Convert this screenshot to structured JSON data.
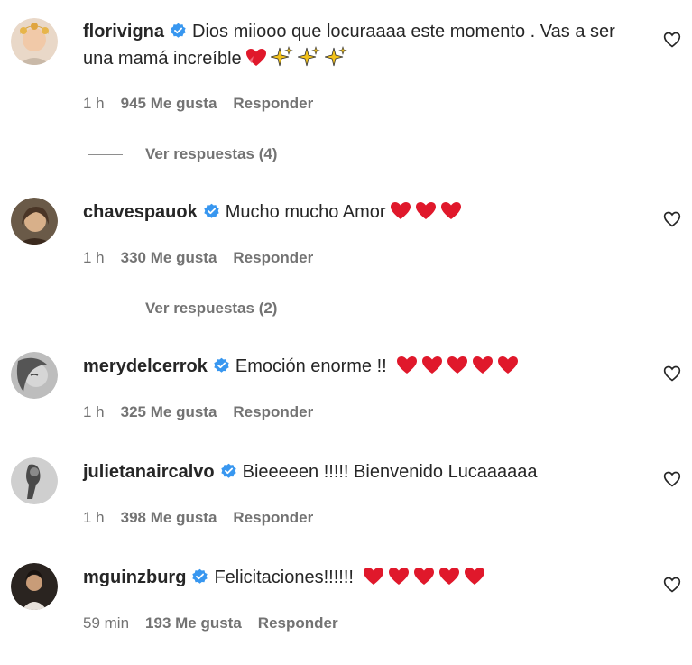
{
  "comments": [
    {
      "username": "florivigna",
      "text": "Dios miiooo que locuraaaa este momento . Vas a ser una mamá increíble",
      "emojis": [
        "heart-ribbon",
        "sparkles",
        "sparkles",
        "sparkles"
      ],
      "time": "1 h",
      "likes": "945 Me gusta",
      "reply": "Responder",
      "replies": "Ver respuestas (4)"
    },
    {
      "username": "chavespauok",
      "text": "Mucho mucho Amor",
      "emojis": [
        "red-heart",
        "red-heart",
        "red-heart"
      ],
      "time": "1 h",
      "likes": "330 Me gusta",
      "reply": "Responder",
      "replies": "Ver respuestas (2)"
    },
    {
      "username": "merydelcerrok",
      "text": "Emoción enorme !!",
      "emojis": [
        "red-heart",
        "red-heart",
        "red-heart",
        "red-heart",
        "red-heart"
      ],
      "time": "1 h",
      "likes": "325 Me gusta",
      "reply": "Responder"
    },
    {
      "username": "julietanaircalvo",
      "text": "Bieeeeen !!!!! Bienvenido Lucaaaaaa",
      "emojis": [],
      "time": "1 h",
      "likes": "398 Me gusta",
      "reply": "Responder"
    },
    {
      "username": "mguinzburg",
      "text": "Felicitaciones!!!!!!",
      "emojis": [
        "red-heart",
        "red-heart",
        "red-heart",
        "red-heart",
        "red-heart"
      ],
      "time": "59 min",
      "likes": "193 Me gusta",
      "reply": "Responder"
    }
  ],
  "colors": {
    "verified": "#3897f0",
    "heart": "#e0182b",
    "sparkle": "#f3c21b",
    "meta": "#737373"
  }
}
